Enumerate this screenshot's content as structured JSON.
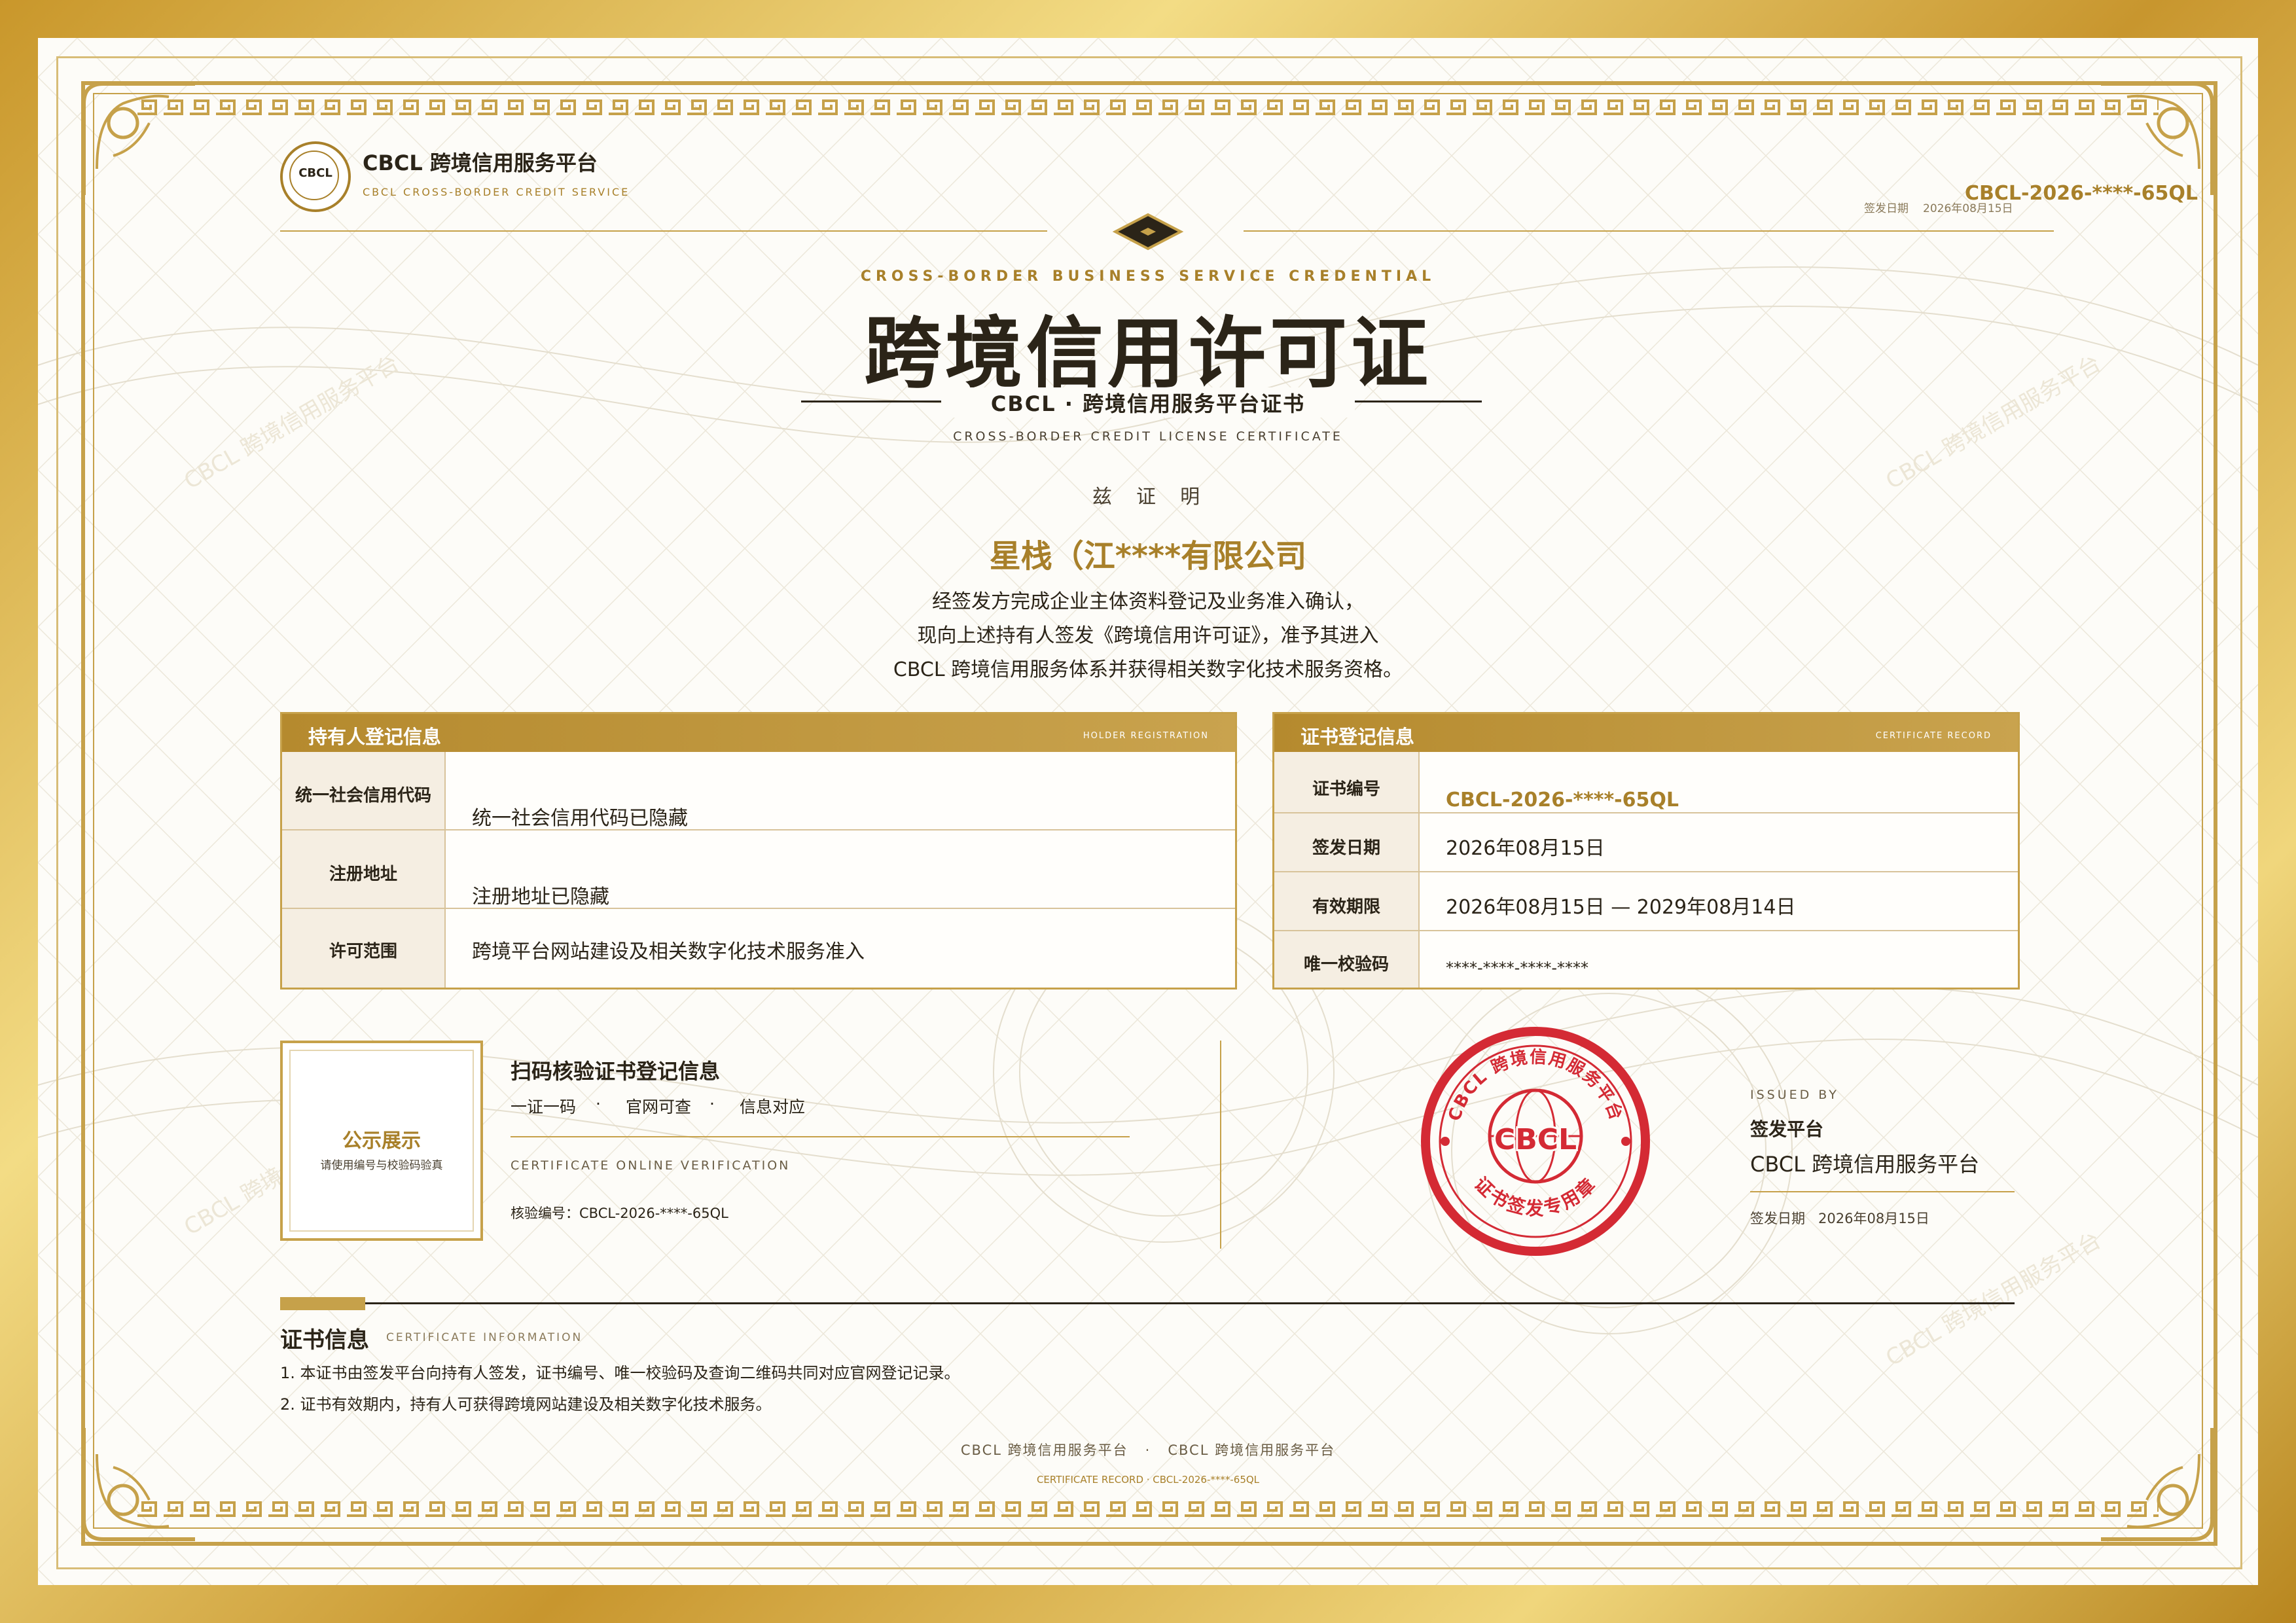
{
  "brand": {
    "name": "CBCL 跨境信用服务平台",
    "subtitle": "CBCL CROSS-BORDER CREDIT SERVICE",
    "logo_text": "CBCL"
  },
  "top_right": {
    "cert_no": "CBCL-2026-****-65QL",
    "date_label": "签发日期",
    "date_value": "2026年08月15日"
  },
  "header": {
    "eyebrow": "CROSS-BORDER BUSINESS SERVICE CREDENTIAL",
    "title": "跨境信用许可证",
    "subtitle": "CBCL · 跨境信用服务平台证书",
    "subtitle_en": "CROSS-BORDER CREDIT LICENSE CERTIFICATE"
  },
  "body": {
    "hereby": "兹  证  明",
    "company": "星栈（江****有限公司",
    "line1": "经签发方完成企业主体资料登记及业务准入确认，",
    "line2": "现向上述持有人签发《跨境信用许可证》，准予其进入",
    "line3": "CBCL 跨境信用服务体系并获得相关数字化技术服务资格。"
  },
  "holder": {
    "title": "持有人登记信息",
    "title_en": "HOLDER REGISTRATION",
    "rows": [
      {
        "label": "统一社会信用代码",
        "value": "统一社会信用代码已隐藏"
      },
      {
        "label": "注册地址",
        "value": "注册地址已隐藏"
      },
      {
        "label": "许可范围",
        "value": "跨境平台网站建设及相关数字化技术服务准入"
      }
    ]
  },
  "record": {
    "title": "证书登记信息",
    "title_en": "CERTIFICATE RECORD",
    "rows": [
      {
        "label": "证书编号",
        "value": "CBCL-2026-****-65QL"
      },
      {
        "label": "签发日期",
        "value": "2026年08月15日"
      },
      {
        "label": "有效期限",
        "value": "2026年08月15日 — 2029年08月14日"
      },
      {
        "label": "唯一校验码",
        "value": "****-****-****-****"
      }
    ]
  },
  "qr": {
    "title": "公示展示",
    "hint": "请使用编号与校验码验真"
  },
  "verify": {
    "title": "扫码核验证书登记信息",
    "items": [
      "一证一码",
      "·",
      "官网可查",
      "·",
      "信息对应"
    ],
    "label_en": "CERTIFICATE ONLINE VERIFICATION",
    "code": "核验编号：CBCL-2026-****-65QL"
  },
  "seal": {
    "top": "CBCL 跨境信用服务平台",
    "center": "CBCL",
    "bottom": "证书签发专用章"
  },
  "issuer": {
    "label_en": "ISSUED BY",
    "label": "签发平台",
    "name": "CBCL 跨境信用服务平台",
    "date": "签发日期   2026年08月15日"
  },
  "info": {
    "title": "证书信息",
    "title_en": "CERTIFICATE INFORMATION",
    "items": [
      "1. 本证书由签发平台向持有人签发，证书编号、唯一校验码及查询二维码共同对应官网登记记录。",
      "2. 证书有效期内，持有人可获得跨境网站建设及相关数字化技术服务。"
    ]
  },
  "footer": {
    "line": "CBCL 跨境信用服务平台   ·   CBCL 跨境信用服务平台",
    "record": "CERTIFICATE RECORD · CBCL-2026-****-65QL"
  },
  "watermark": "CBCL 跨境信用服务平台",
  "colors": {
    "gold": "#c6a14a",
    "gold_dark": "#a8802a",
    "seal_red": "#d42a34",
    "text": "#2b2418"
  }
}
